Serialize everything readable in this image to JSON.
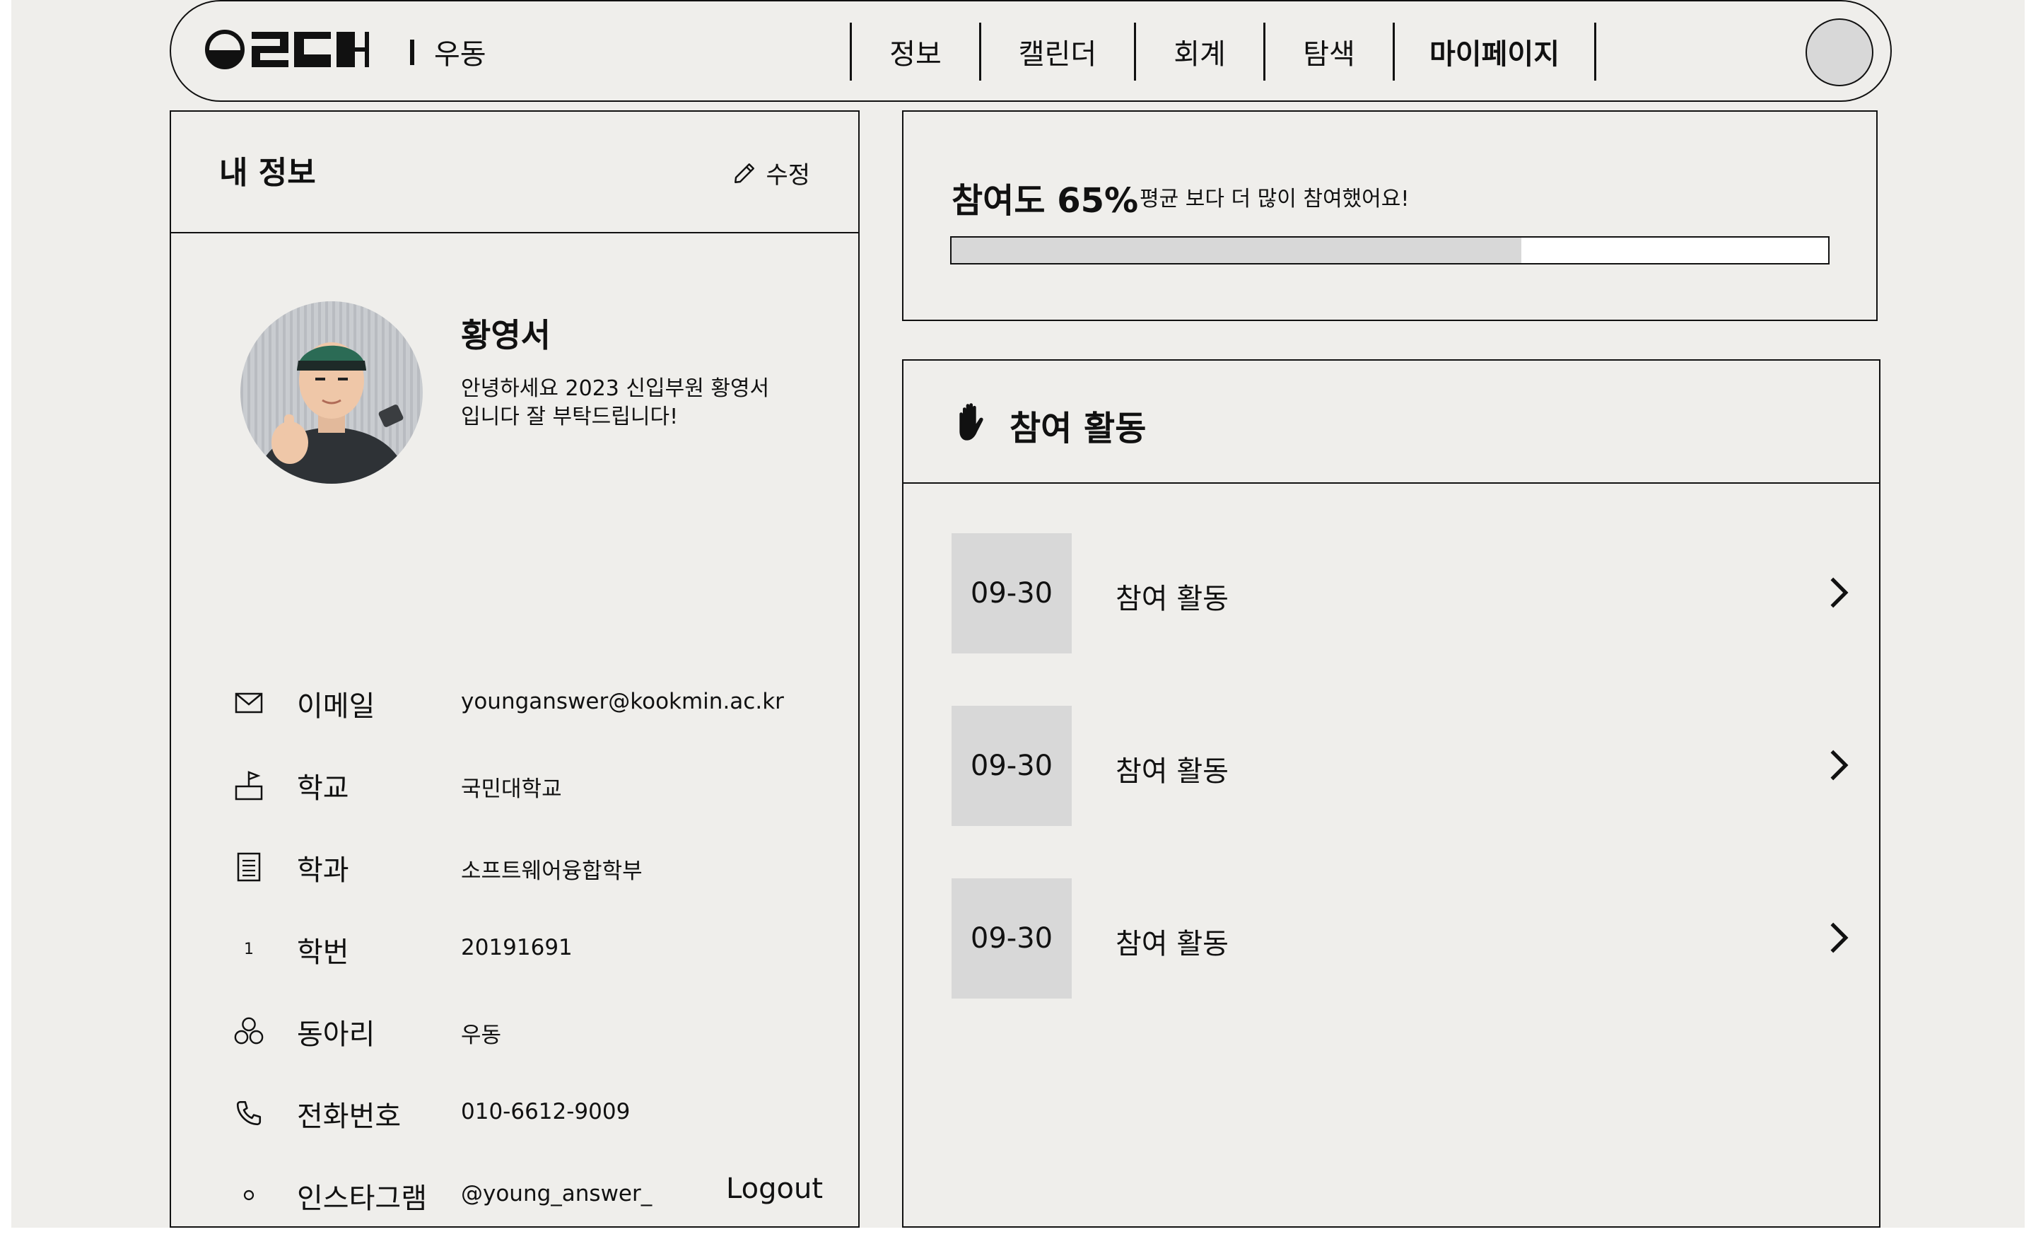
{
  "header": {
    "logo_alt": "OLLH",
    "club_name": "우동",
    "nav": [
      "정보",
      "캘린더",
      "회계",
      "탐색",
      "마이페이지"
    ],
    "active_nav": "마이페이지"
  },
  "profile": {
    "section_title": "내 정보",
    "edit_label": "수정",
    "name": "황영서",
    "intro_line1": "안녕하세요 2023 신입부원 황영서",
    "intro_line2": "입니다 잘 부탁드립니다!",
    "rows": [
      {
        "icon": "mail-icon",
        "label": "이메일",
        "value": "younganswer@kookmin.ac.kr"
      },
      {
        "icon": "school-icon",
        "label": "학교",
        "value": "국민대학교"
      },
      {
        "icon": "document-icon",
        "label": "학과",
        "value": "소프트웨어융합학부"
      },
      {
        "icon": "number-icon",
        "label": "학번",
        "value": "20191691",
        "icon_text": "1"
      },
      {
        "icon": "group-icon",
        "label": "동아리",
        "value": "우동"
      },
      {
        "icon": "phone-icon",
        "label": "전화번호",
        "value": "010-6612-9009"
      },
      {
        "icon": "circle-icon",
        "label": "인스타그램",
        "value": "@young_answer_"
      }
    ],
    "logout_label": "Logout"
  },
  "participation": {
    "title": "참여도 65%",
    "subtitle": "평균 보다 더 많이 참여했어요!",
    "progress": 0.65
  },
  "activities": {
    "title": "참여 활동",
    "items": [
      {
        "date": "09-30",
        "label": "참여 활동"
      },
      {
        "date": "09-30",
        "label": "참여 활동"
      },
      {
        "date": "09-30",
        "label": "참여 활동"
      }
    ]
  },
  "colors": {
    "background": "#efeeeb",
    "border": "#111111",
    "accent_gray": "#d8d8d8"
  }
}
